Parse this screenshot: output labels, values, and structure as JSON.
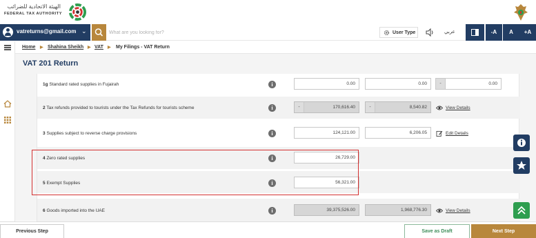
{
  "header": {
    "org_arabic": "الهيئة الاتحادية للضرائب",
    "org_english": "FEDERAL TAX AUTHORITY"
  },
  "toolbar": {
    "account_email": "vatreturns@gmail.com",
    "search_placeholder": "What are you looking for?",
    "user_type_label": "User Type",
    "language_link": "عربي",
    "font_decrease": "-A",
    "font_normal": "A",
    "font_increase": "+A"
  },
  "breadcrumb": {
    "items": [
      "Home",
      "Shahina Sheikh",
      "VAT",
      "My Filings - VAT Return"
    ]
  },
  "page": {
    "title": "VAT 201 Return"
  },
  "rows": [
    {
      "num": "1g",
      "label": "Standard rated supplies in Fujairah",
      "amount": "0.00",
      "vat": "0.00",
      "adjustment": "0.00",
      "adjustment_prefix": "-"
    },
    {
      "num": "2",
      "label": "Tax refunds provided to tourists under the Tax Refunds for tourists scheme",
      "amount_prefix": "-",
      "amount": "170,616.40",
      "vat_prefix": "-",
      "vat": "8,540.82",
      "action": "View Details"
    },
    {
      "num": "3",
      "label": "Supplies subject to reverse charge provisions",
      "amount": "124,121.00",
      "vat": "6,206.05",
      "action": "Edit Details"
    },
    {
      "num": "4",
      "label": "Zero rated supplies",
      "amount": "26,729.00"
    },
    {
      "num": "5",
      "label": "Exempt Supplies",
      "amount": "56,321.00"
    },
    {
      "num": "6",
      "label": "Goods imported into the UAE",
      "amount": "39,375,526.00",
      "vat": "1,968,776.30",
      "action": "View Details"
    }
  ],
  "footer": {
    "previous": "Previous Step",
    "save_draft": "Save as Draft",
    "next": "Next Step"
  },
  "colors": {
    "navy": "#223d63",
    "gold": "#b8873c",
    "highlight": "#d32f2f",
    "green": "#2e9e4f"
  }
}
